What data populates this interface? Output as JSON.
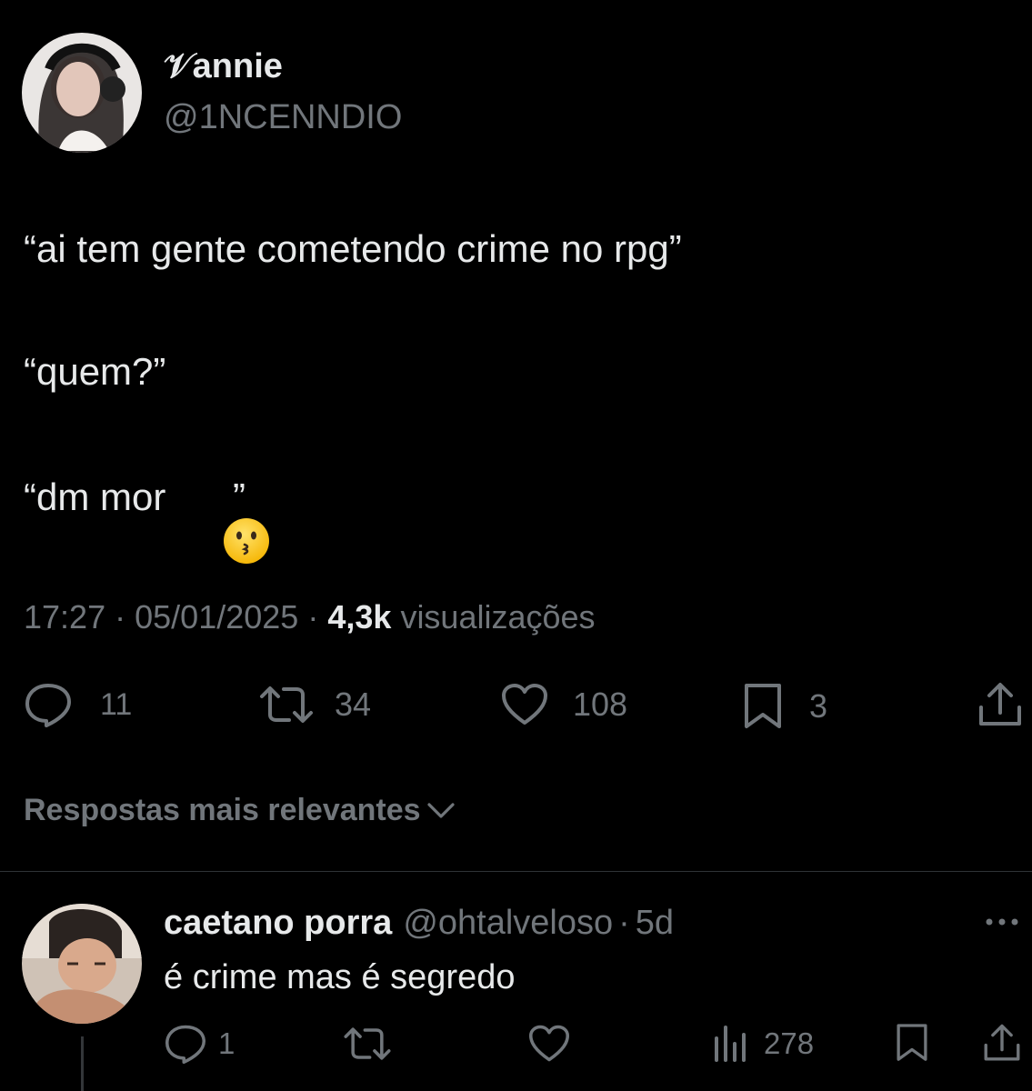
{
  "tweet": {
    "author_name": "𝒱annie",
    "author_handle": "@1NCENNDIO",
    "lines": [
      "“ai tem gente cometendo crime no rpg”",
      "“quem?”",
      "“dm mor ",
      "”"
    ],
    "emoji_name": "kissing-face-emoji",
    "time": "17:27",
    "date": "05/01/2025",
    "views_count": "4,3k",
    "views_label": "visualizações",
    "sep": "·",
    "actions": {
      "replies": "11",
      "retweets": "34",
      "likes": "108",
      "bookmarks": "3"
    }
  },
  "replies_sort": {
    "label": "Respostas mais relevantes"
  },
  "reply": {
    "author_name": "caetano porra",
    "author_handle": "@ohtalveloso",
    "sep": "·",
    "age": "5d",
    "text": "é crime mas é segredo",
    "actions": {
      "replies": "1",
      "views": "278"
    }
  },
  "icons": {
    "reply": "speech-bubble-icon",
    "retweet": "retweet-icon",
    "like": "heart-icon",
    "bookmark": "bookmark-icon",
    "share": "share-icon",
    "views": "bar-chart-icon",
    "more": "more-dots-icon",
    "sort": "chevron-down-icon"
  },
  "colors": {
    "background": "#000000",
    "text": "#e7e9ea",
    "muted": "#71767b",
    "divider": "#2f3336"
  }
}
